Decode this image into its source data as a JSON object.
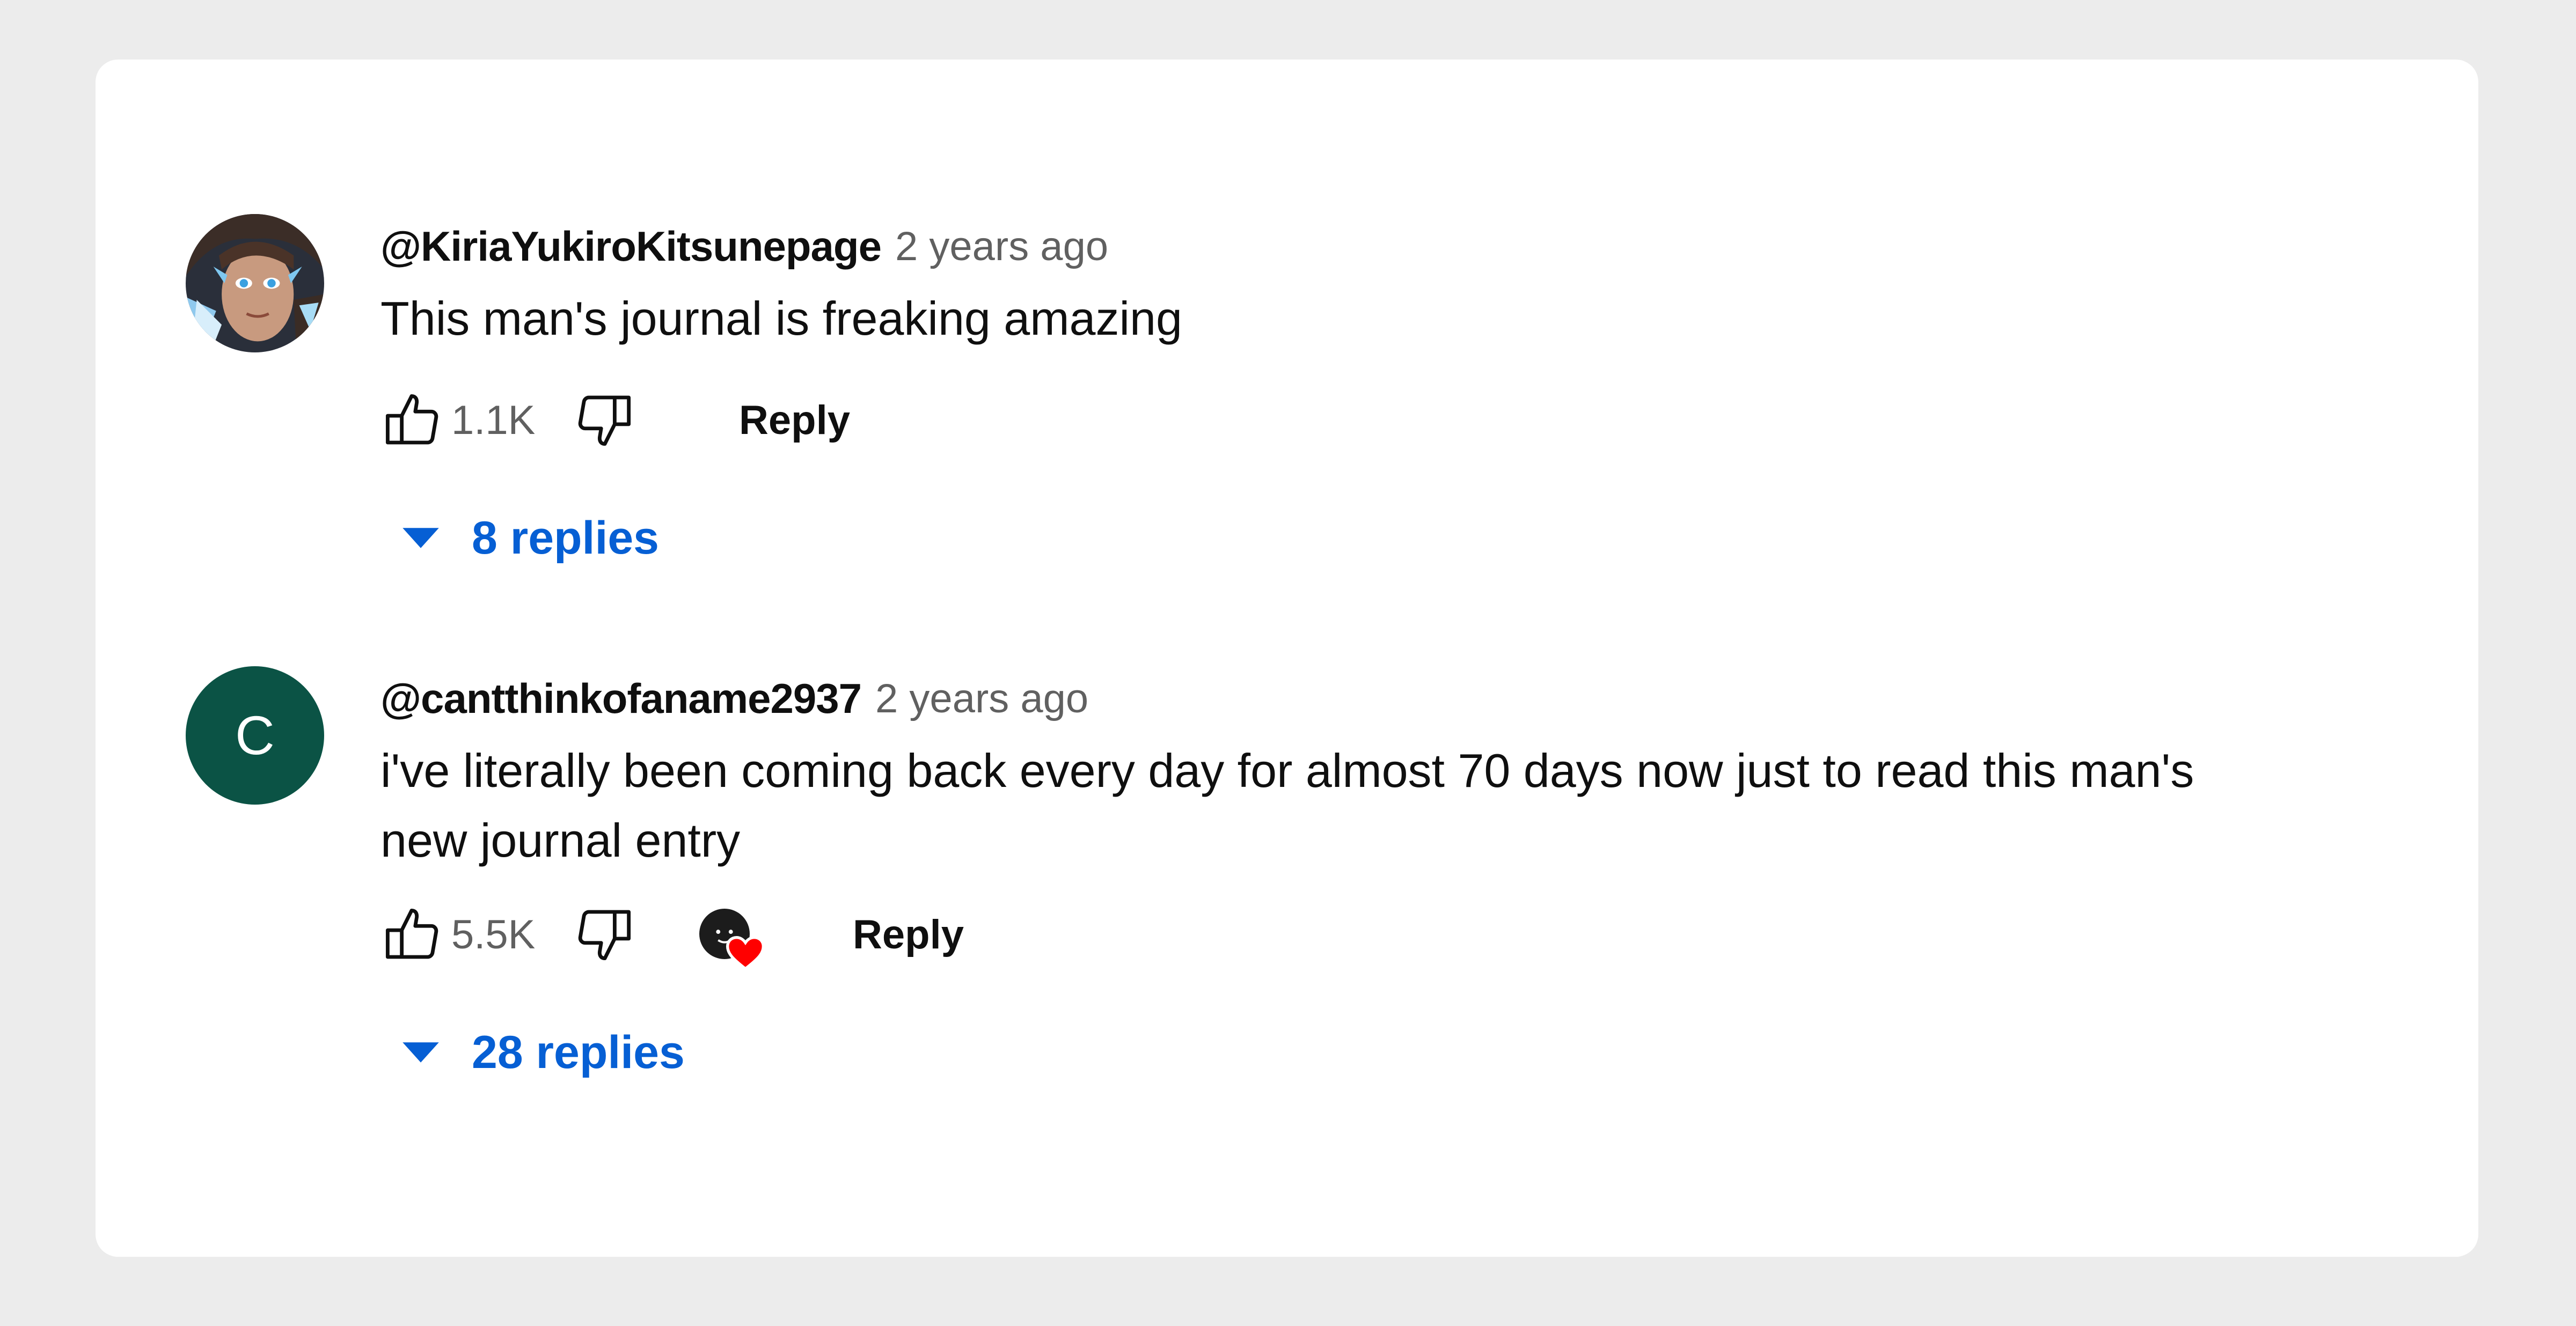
{
  "colors": {
    "background": "#ececec",
    "card": "#ffffff",
    "author": "#0f0f0f",
    "timestamp": "#606060",
    "link": "#065fd4",
    "avatar_c": "#0b5345",
    "heart": "#ff0000"
  },
  "comments": [
    {
      "author": "@KiriaYukiroKitsunepage",
      "time": "2 years ago",
      "text": "This man's journal is freaking amazing",
      "likes": "1.1K",
      "reply_label": "Reply",
      "replies_label": "8 replies",
      "avatar": {
        "type": "image",
        "icon": "user-avatar-drawing"
      },
      "creator_heart": false
    },
    {
      "author": "@cantthinkofaname2937",
      "time": "2 years ago",
      "text": "i've literally been coming back every day for almost 70 days now just to read this man's new journal entry",
      "likes": "5.5K",
      "reply_label": "Reply",
      "replies_label": "28 replies",
      "avatar": {
        "type": "letter",
        "letter": "C"
      },
      "creator_heart": true
    }
  ],
  "icons": {
    "like": "thumbs-up-icon",
    "dislike": "thumbs-down-icon",
    "expand": "caret-down-icon",
    "creator_heart": "creator-heart-icon"
  }
}
